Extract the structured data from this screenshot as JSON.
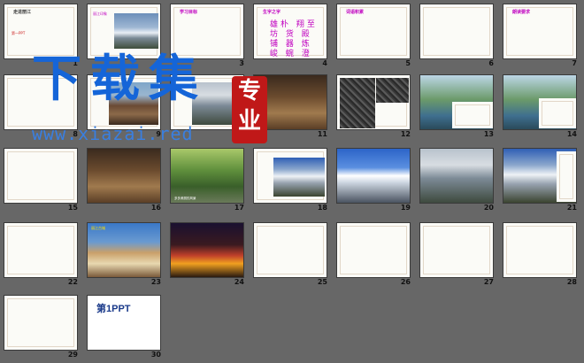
{
  "window": {
    "title": "走进丽江"
  },
  "watermark": {
    "text": "下载集",
    "seal": "专业",
    "url": "www.xiazai.red"
  },
  "colors": {
    "background": "#676767",
    "accent": "#c000c0",
    "watermark": "#1565d8",
    "seal": "#c01818"
  },
  "slides": [
    {
      "num": "1",
      "title": "走进丽江",
      "subtitle": "第一PPT"
    },
    {
      "num": "2",
      "title": "丽江印象"
    },
    {
      "num": "3",
      "title": "学习目标"
    },
    {
      "num": "4",
      "title": "生字之字",
      "body": "雄朴 翔至 坊 货 殿 铺 器 炼 峻 蜿 澄 蔷"
    },
    {
      "num": "5",
      "title": "词语积累"
    },
    {
      "num": "6",
      "title": ""
    },
    {
      "num": "7",
      "title": "朗读要求"
    },
    {
      "num": "8",
      "title": ""
    },
    {
      "num": "9",
      "title": ""
    },
    {
      "num": "10",
      "title": ""
    },
    {
      "num": "11",
      "title": ""
    },
    {
      "num": "12",
      "title": ""
    },
    {
      "num": "13",
      "title": ""
    },
    {
      "num": "14",
      "title": ""
    },
    {
      "num": "15",
      "title": ""
    },
    {
      "num": "16",
      "title": ""
    },
    {
      "num": "17",
      "title": ""
    },
    {
      "num": "18",
      "title": ""
    },
    {
      "num": "19",
      "title": ""
    },
    {
      "num": "20",
      "title": ""
    },
    {
      "num": "21",
      "title": ""
    },
    {
      "num": "22",
      "title": ""
    },
    {
      "num": "23",
      "title": ""
    },
    {
      "num": "24",
      "title": ""
    },
    {
      "num": "25",
      "title": ""
    },
    {
      "num": "26",
      "title": ""
    },
    {
      "num": "27",
      "title": ""
    },
    {
      "num": "28",
      "title": ""
    },
    {
      "num": "29",
      "title": ""
    },
    {
      "num": "30",
      "title": "第1PPT"
    }
  ],
  "captions": {
    "s17": "多多美丽的风景",
    "s23": "丽江古城",
    "s30": "第1PPT"
  },
  "icons": {
    "seal": "seal-icon"
  }
}
